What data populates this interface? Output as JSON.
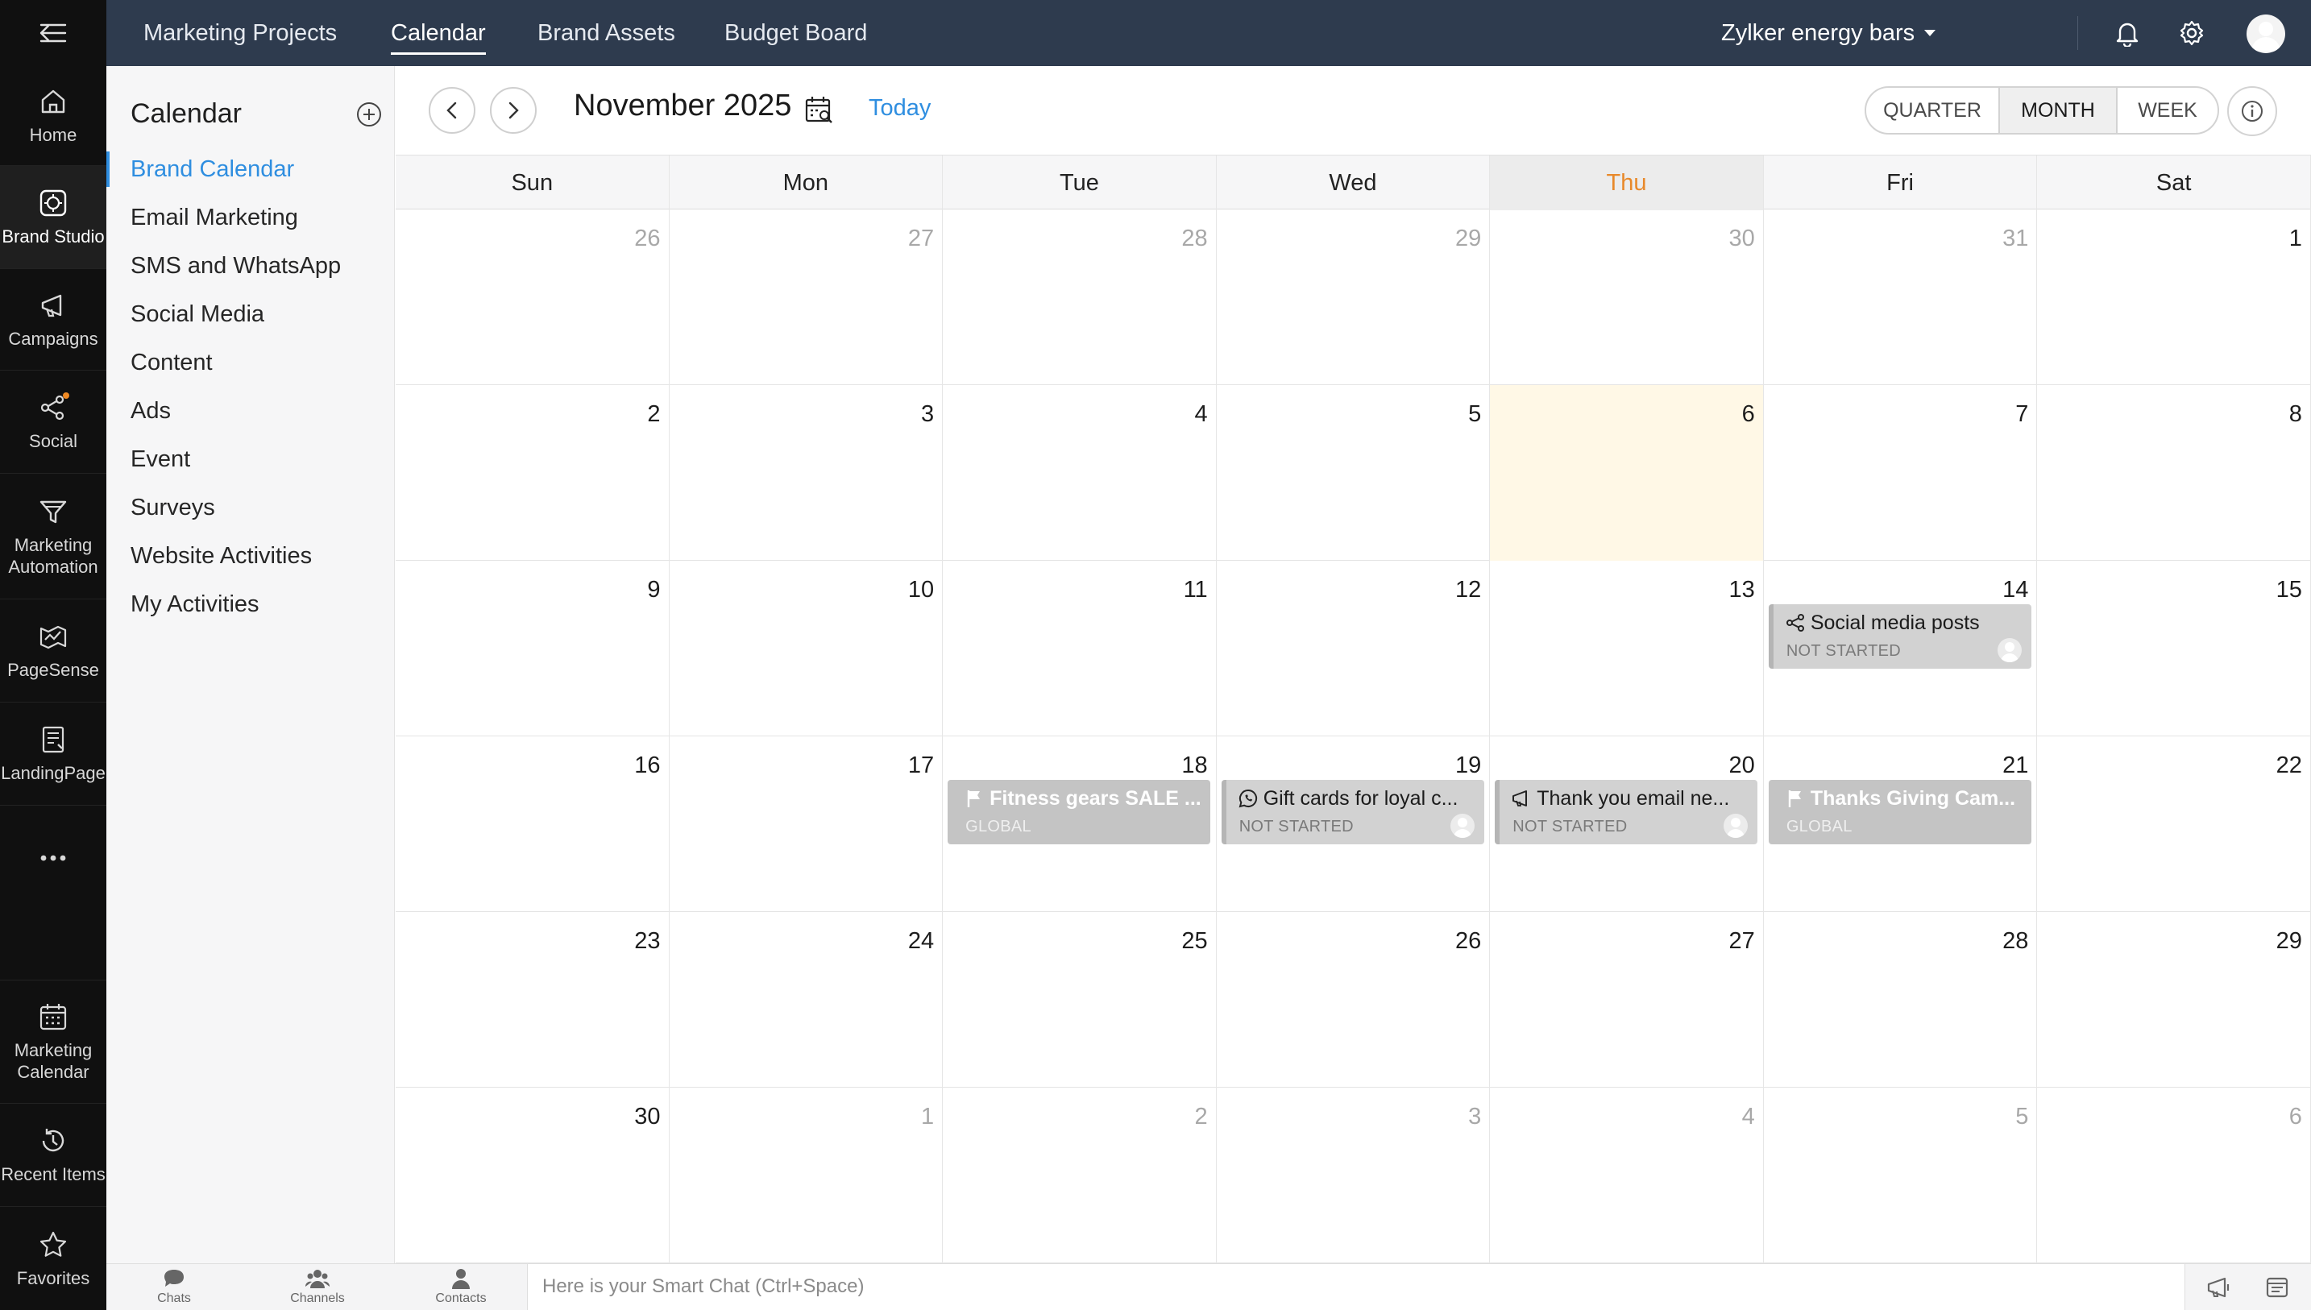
{
  "rail": {
    "items": [
      {
        "label": "Home",
        "icon": "home-icon"
      },
      {
        "label": "Brand Studio",
        "icon": "brand-studio-icon",
        "active": true
      },
      {
        "label": "Campaigns",
        "icon": "megaphone-icon"
      },
      {
        "label": "Social",
        "icon": "social-icon",
        "badge": true
      },
      {
        "label": "Marketing Automation",
        "icon": "funnel-icon"
      },
      {
        "label": "PageSense",
        "icon": "pagesense-icon"
      },
      {
        "label": "LandingPage",
        "icon": "landing-page-icon"
      },
      {
        "label": "Marketing Calendar",
        "icon": "calendar-icon"
      },
      {
        "label": "Recent Items",
        "icon": "history-icon"
      },
      {
        "label": "Favorites",
        "icon": "star-icon"
      }
    ]
  },
  "topbar": {
    "tabs": [
      "Marketing Projects",
      "Calendar",
      "Brand Assets",
      "Budget Board"
    ],
    "active_tab": "Calendar",
    "org_name": "Zylker energy bars"
  },
  "side": {
    "title": "Calendar",
    "items": [
      "Brand Calendar",
      "Email Marketing",
      "SMS and WhatsApp",
      "Social Media",
      "Content",
      "Ads",
      "Event",
      "Surveys",
      "Website Activities",
      "My Activities"
    ],
    "active_item": "Brand Calendar"
  },
  "toolbar": {
    "month_title": "November 2025",
    "today_label": "Today",
    "views": [
      "QUARTER",
      "MONTH",
      "WEEK"
    ],
    "active_view": "MONTH"
  },
  "calendar": {
    "days_of_week": [
      "Sun",
      "Mon",
      "Tue",
      "Wed",
      "Thu",
      "Fri",
      "Sat"
    ],
    "today_column": 4,
    "weeks": [
      [
        {
          "d": "26",
          "o": true
        },
        {
          "d": "27",
          "o": true
        },
        {
          "d": "28",
          "o": true
        },
        {
          "d": "29",
          "o": true
        },
        {
          "d": "30",
          "o": true
        },
        {
          "d": "31",
          "o": true
        },
        {
          "d": "1"
        }
      ],
      [
        {
          "d": "2"
        },
        {
          "d": "3"
        },
        {
          "d": "4"
        },
        {
          "d": "5"
        },
        {
          "d": "6",
          "today": true
        },
        {
          "d": "7"
        },
        {
          "d": "8"
        }
      ],
      [
        {
          "d": "9"
        },
        {
          "d": "10"
        },
        {
          "d": "11"
        },
        {
          "d": "12"
        },
        {
          "d": "13"
        },
        {
          "d": "14",
          "event": {
            "kind": "task",
            "icon": "share-icon",
            "title": "Social media posts",
            "status": "NOT STARTED"
          }
        },
        {
          "d": "15"
        }
      ],
      [
        {
          "d": "16"
        },
        {
          "d": "17"
        },
        {
          "d": "18",
          "event": {
            "kind": "campaign",
            "icon": "flag-icon",
            "title": "Fitness gears SALE ...",
            "status": "GLOBAL"
          }
        },
        {
          "d": "19",
          "event": {
            "kind": "task",
            "icon": "whatsapp-icon",
            "title": "Gift cards for loyal c...",
            "status": "NOT STARTED"
          }
        },
        {
          "d": "20",
          "event": {
            "kind": "task",
            "icon": "megaphone-icon",
            "title": "Thank you email ne...",
            "status": "NOT STARTED"
          }
        },
        {
          "d": "21",
          "event": {
            "kind": "campaign",
            "icon": "flag-icon",
            "title": "Thanks Giving Cam...",
            "status": "GLOBAL"
          }
        },
        {
          "d": "22"
        }
      ],
      [
        {
          "d": "23"
        },
        {
          "d": "24"
        },
        {
          "d": "25"
        },
        {
          "d": "26"
        },
        {
          "d": "27"
        },
        {
          "d": "28"
        },
        {
          "d": "29"
        }
      ],
      [
        {
          "d": "30"
        },
        {
          "d": "1",
          "o": true
        },
        {
          "d": "2",
          "o": true
        },
        {
          "d": "3",
          "o": true
        },
        {
          "d": "4",
          "o": true
        },
        {
          "d": "5",
          "o": true
        },
        {
          "d": "6",
          "o": true
        }
      ]
    ]
  },
  "bottombar": {
    "items": [
      "Chats",
      "Channels",
      "Contacts"
    ],
    "smart_chat_placeholder": "Here is your Smart Chat (Ctrl+Space)"
  },
  "colors": {
    "topbar": "#2e3b4e",
    "rail": "#101010",
    "accent": "#2f8ee0",
    "today_header": "#e8892a",
    "today_cell": "#fff8e6",
    "notification_dot": "#f08a24"
  }
}
